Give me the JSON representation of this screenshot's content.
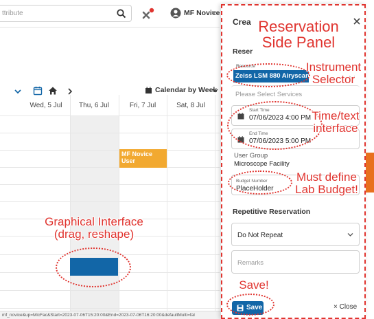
{
  "topbar": {
    "search_placeholder": "ttribute",
    "user_name": "MF Novice User"
  },
  "toolbar": {
    "view_label": "Calendar by Week"
  },
  "calendar": {
    "days": [
      "Wed, 5 Jul",
      "Thu, 6 Jul",
      "Fri, 7 Jul",
      "Sat, 8 Jul"
    ],
    "event_label": "MF Novice User",
    "status_url": "mf_novice&up=MicFac&Start=2023-07-06T15:20:00&End=2023-07-06T16:20:00&defaultMulti=fal"
  },
  "panel": {
    "title": "Crea",
    "subtitle": "Reser",
    "resource_label": "Resource",
    "resource_value": "Zeiss LSM 880 Airyscan",
    "services_placeholder": "Please Select Services",
    "start_label": "Start Time",
    "start_value": "07/06/2023 4:00 PM",
    "end_label": "End Time",
    "end_value": "07/06/2023 5:00 PM",
    "group_label": "User Group",
    "group_value": "Microscope Facility",
    "budget_label": "Budget Number",
    "budget_value": "PlaceHolder",
    "repeat_heading": "Repetitive Reservation",
    "repeat_value": "Do Not Repeat",
    "remarks_placeholder": "Remarks",
    "save_label": "Save",
    "close_label": "× Close"
  },
  "annotations": {
    "side_panel": "Reservation\nSide Panel",
    "instrument": "Instrument\nSelector",
    "time": "Time/text\ninterface",
    "budget": "Must define\nLab Budget!",
    "graphical": "Graphical Interface\n(drag, reshape)",
    "save": "Save!"
  },
  "colors": {
    "accent_blue": "#1266a7",
    "event_orange": "#f2a930",
    "annotation_red": "#e0342f"
  }
}
